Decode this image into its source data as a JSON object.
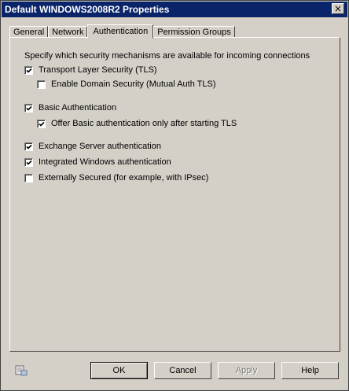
{
  "window": {
    "title": "Default WINDOWS2008R2 Properties",
    "close_label": "×"
  },
  "tabs": [
    {
      "label": "General",
      "active": false
    },
    {
      "label": "Network",
      "active": false
    },
    {
      "label": "Authentication",
      "active": true
    },
    {
      "label": "Permission Groups",
      "active": false
    }
  ],
  "auth": {
    "intro": "Specify which security mechanisms are available for incoming connections",
    "options": [
      {
        "label": "Transport Layer Security (TLS)",
        "checked": true
      },
      {
        "label": "Enable Domain Security (Mutual Auth TLS)",
        "checked": false
      },
      {
        "label": "Basic Authentication",
        "checked": true
      },
      {
        "label": "Offer Basic authentication only after starting TLS",
        "checked": true
      },
      {
        "label": "Exchange Server authentication",
        "checked": true
      },
      {
        "label": "Integrated Windows authentication",
        "checked": true
      },
      {
        "label": "Externally Secured (for example, with IPsec)",
        "checked": false
      }
    ]
  },
  "buttons": {
    "ok": "OK",
    "cancel": "Cancel",
    "apply": "Apply",
    "help": "Help"
  }
}
